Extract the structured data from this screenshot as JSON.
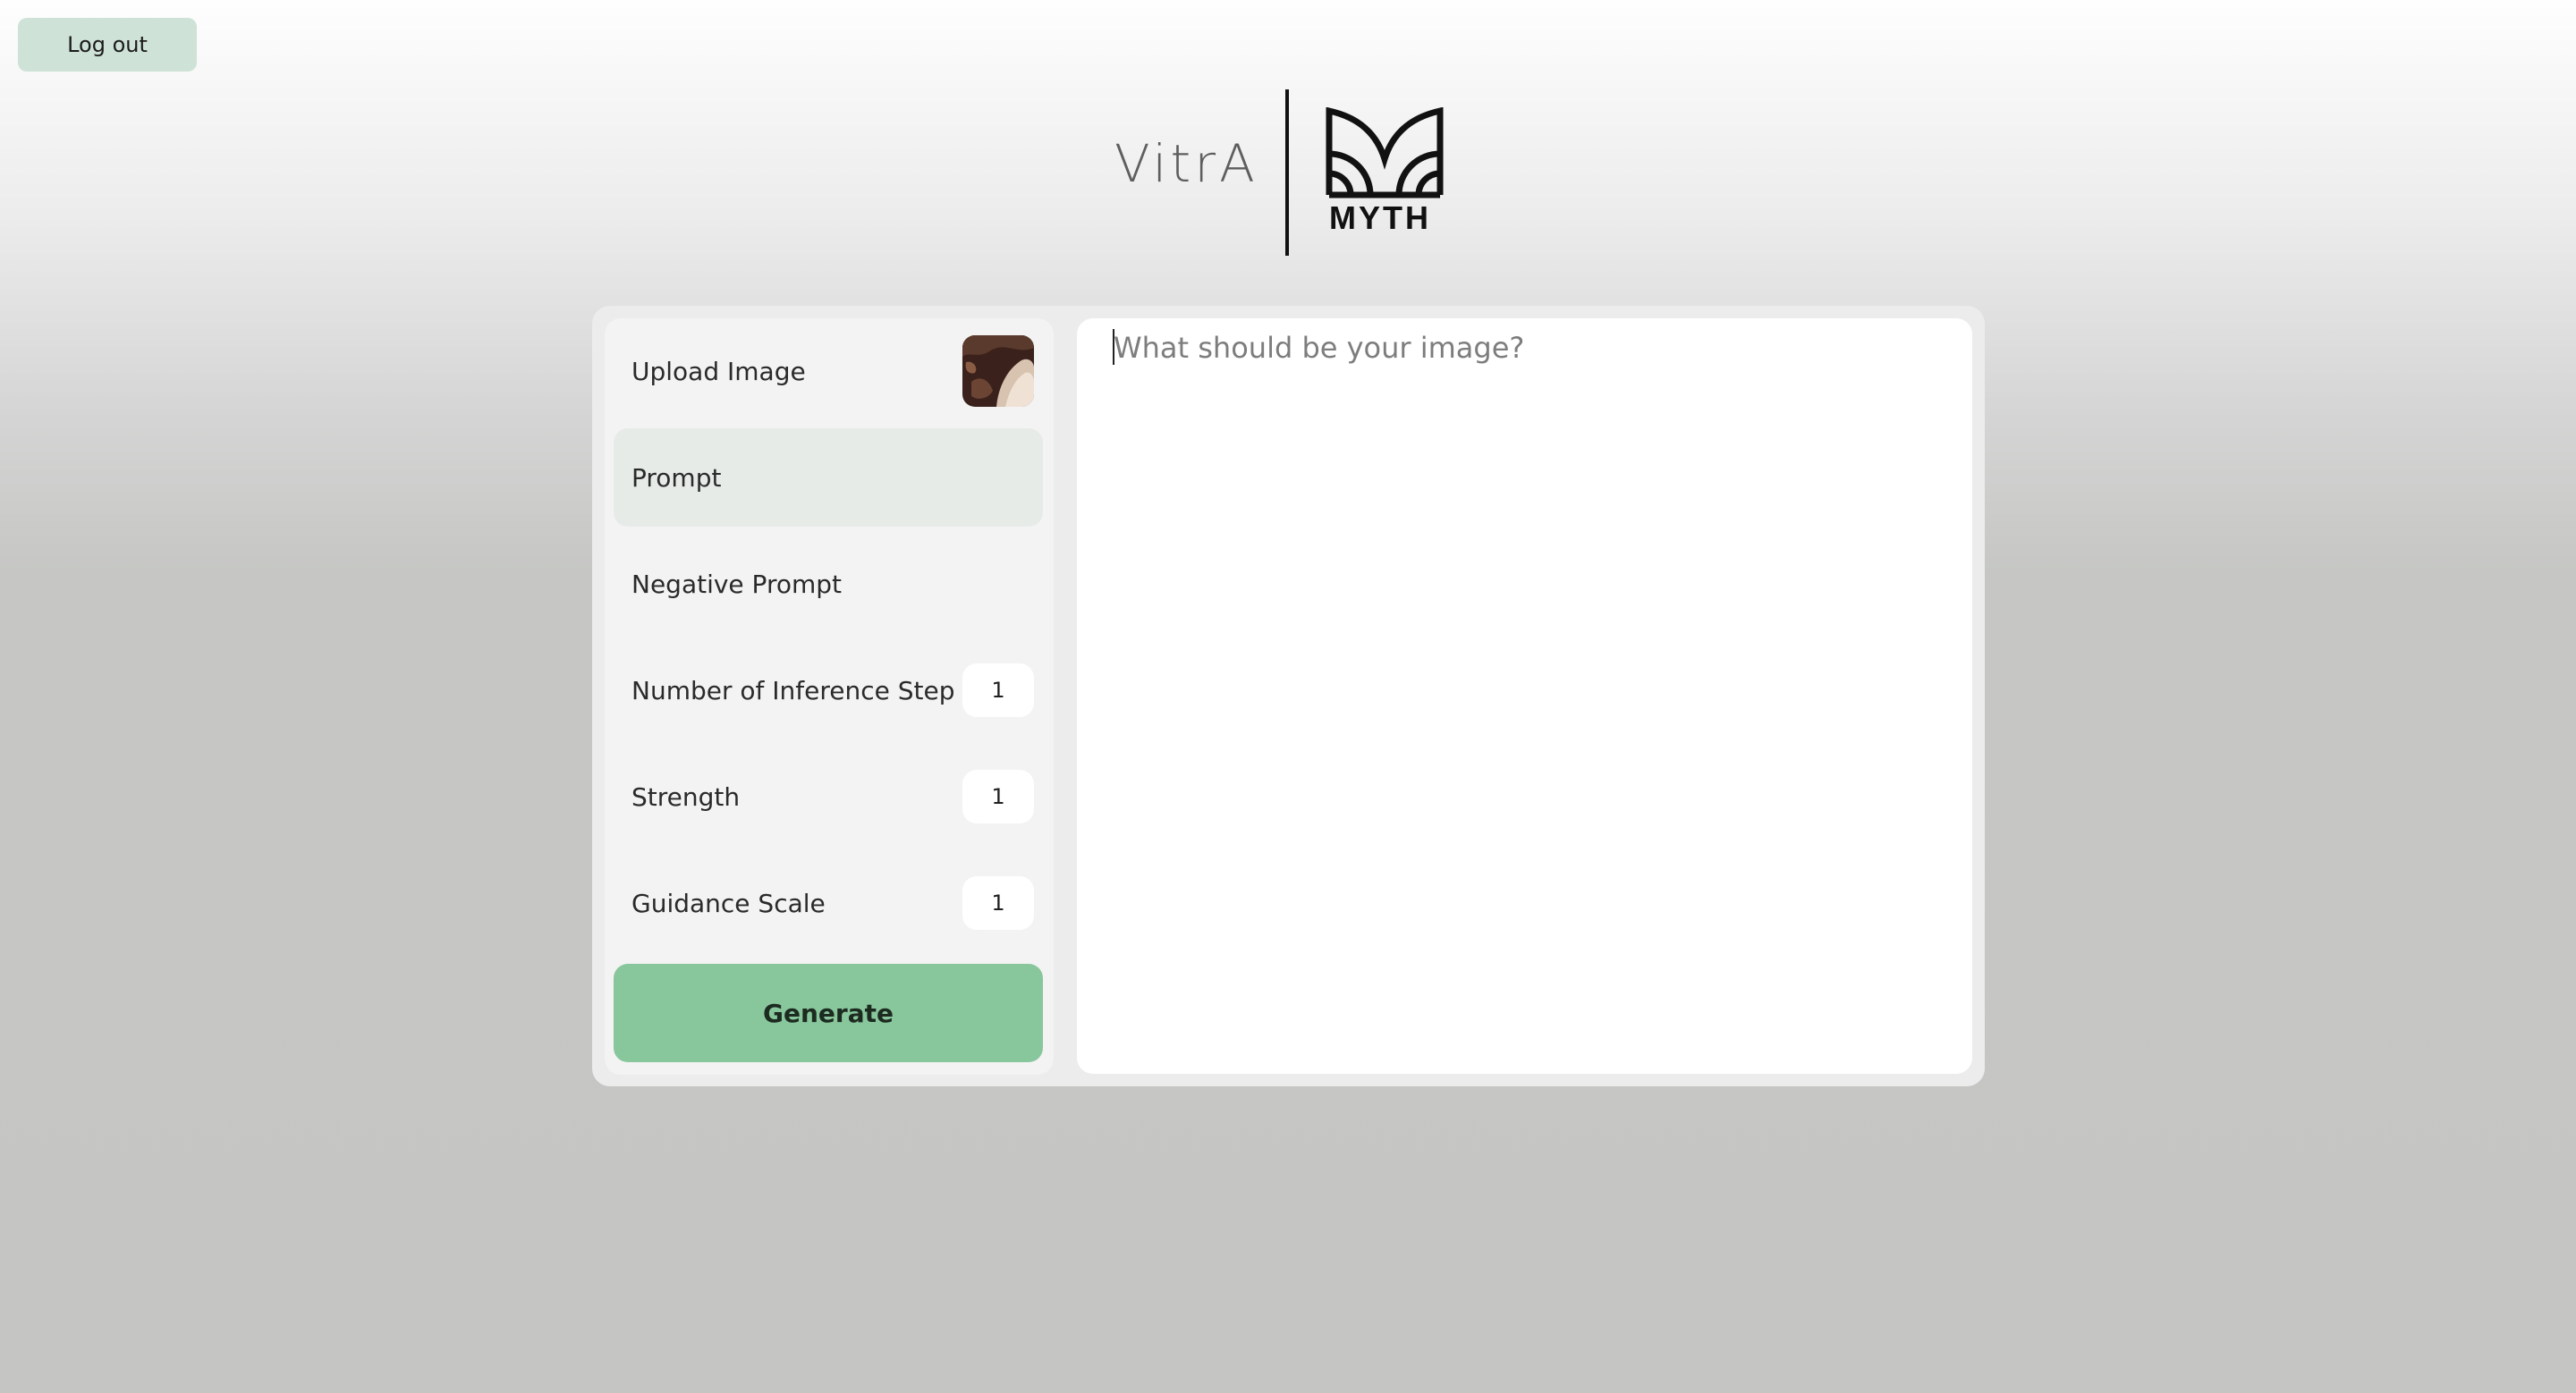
{
  "header": {
    "logout_label": "Log out",
    "brand_left": "VitrA",
    "brand_right": "MYTH"
  },
  "sidebar": {
    "upload_label": "Upload Image",
    "uploaded_image": "uploaded-thumbnail",
    "prompt_label": "Prompt",
    "negative_prompt_label": "Negative Prompt",
    "inference_steps": {
      "label": "Number of Inference Step",
      "value": "1"
    },
    "strength": {
      "label": "Strength",
      "value": "1"
    },
    "guidance_scale": {
      "label": "Guidance Scale",
      "value": "1"
    },
    "generate_label": "Generate"
  },
  "prompt_area": {
    "placeholder": "What should be your image?"
  },
  "colors": {
    "accent": "#88c69c",
    "logout_bg": "#cfe2d7",
    "active_row": "#e6ebe8"
  }
}
